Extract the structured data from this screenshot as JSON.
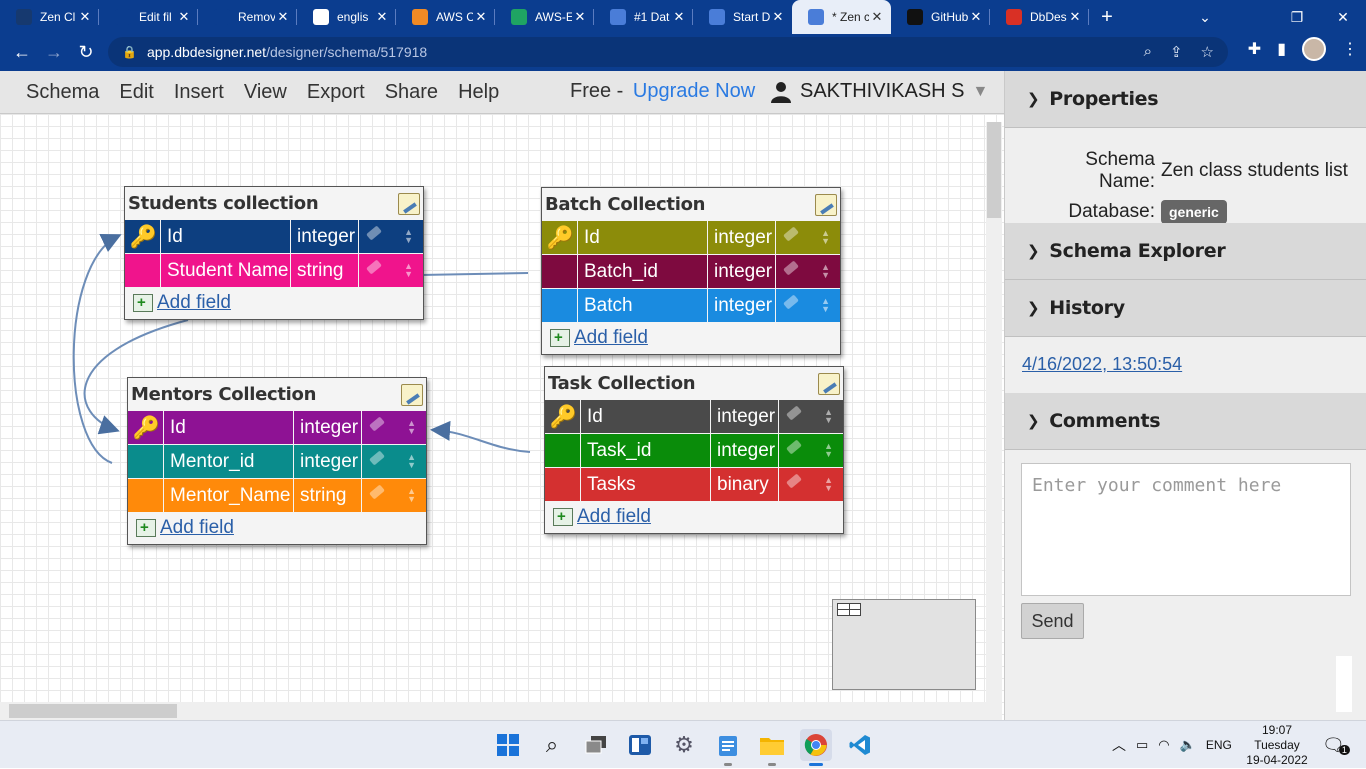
{
  "browser": {
    "tabs": [
      {
        "title": "Zen Cl",
        "icon": "zen-icon",
        "color": "#16396f"
      },
      {
        "title": "Edit fil",
        "icon": "cloud-icon",
        "color": "#0b3d8f"
      },
      {
        "title": "Remov",
        "icon": "remove-icon",
        "color": "#0b3d8f"
      },
      {
        "title": "englis",
        "icon": "google-icon",
        "color": "#ffffff"
      },
      {
        "title": "AWS C",
        "icon": "aws-icon",
        "color": "#f08a24"
      },
      {
        "title": "AWS-E",
        "icon": "drive-icon",
        "color": "#1fa463"
      },
      {
        "title": "#1 Dat",
        "icon": "doc-icon",
        "color": "#4a7dd8"
      },
      {
        "title": "Start D",
        "icon": "doc-icon",
        "color": "#4a7dd8"
      },
      {
        "title": "* Zen c",
        "icon": "doc-icon",
        "color": "#4a7dd8"
      },
      {
        "title": "GitHub",
        "icon": "github-icon",
        "color": "#111111"
      },
      {
        "title": "DbDes",
        "icon": "gmail-icon",
        "color": "#d93025"
      }
    ],
    "close_glyph": "✕",
    "new_tab_glyph": "+",
    "url_host": "app.dbdesigner.net",
    "url_path": "/designer/schema/517918"
  },
  "menu": {
    "items": [
      "Schema",
      "Edit",
      "Insert",
      "View",
      "Export",
      "Share",
      "Help"
    ],
    "plan": "Free -",
    "upgrade": "Upgrade Now",
    "user": "SAKTHIVIKASH S"
  },
  "tables": {
    "students": {
      "title": "Students collection",
      "rows": [
        {
          "name": "Id",
          "type": "integer",
          "color": "#0d3f80",
          "key": true
        },
        {
          "name": "Student Name",
          "type": "string",
          "color": "#f0148c",
          "key": false
        }
      ],
      "add": "Add field"
    },
    "batch": {
      "title": "Batch Collection",
      "rows": [
        {
          "name": "Id",
          "type": "integer",
          "color": "#8c8c0a",
          "key": true
        },
        {
          "name": "Batch_id",
          "type": "integer",
          "color": "#7e0a3f",
          "key": false
        },
        {
          "name": "Batch",
          "type": "integer",
          "color": "#1a8be0",
          "key": false
        }
      ],
      "add": "Add field"
    },
    "mentors": {
      "title": "Mentors Collection",
      "rows": [
        {
          "name": "Id",
          "type": "integer",
          "color": "#8e1294",
          "key": true
        },
        {
          "name": "Mentor_id",
          "type": "integer",
          "color": "#0a8c8c",
          "key": false
        },
        {
          "name": "Mentor_Name",
          "type": "string",
          "color": "#ff8a0a",
          "key": false
        }
      ],
      "add": "Add field"
    },
    "task": {
      "title": "Task Collection",
      "rows": [
        {
          "name": "Id",
          "type": "integer",
          "color": "#4a4a4a",
          "key": true
        },
        {
          "name": "Task_id",
          "type": "integer",
          "color": "#0a8c0a",
          "key": false
        },
        {
          "name": "Tasks",
          "type": "binary",
          "color": "#d43030",
          "key": false
        }
      ],
      "add": "Add field"
    }
  },
  "panel": {
    "properties": "Properties",
    "schema_name_label": "Schema Name:",
    "schema_name": "Zen class students list",
    "database_label": "Database:",
    "database": "generic",
    "explorer": "Schema Explorer",
    "history": "History",
    "history_entry": "4/16/2022, 13:50:54",
    "comments": "Comments",
    "comment_placeholder": "Enter your comment here",
    "send": "Send"
  },
  "taskbar": {
    "lang": "ENG",
    "time": "19:07",
    "day": "Tuesday",
    "date": "19-04-2022",
    "notif_count": "1"
  }
}
